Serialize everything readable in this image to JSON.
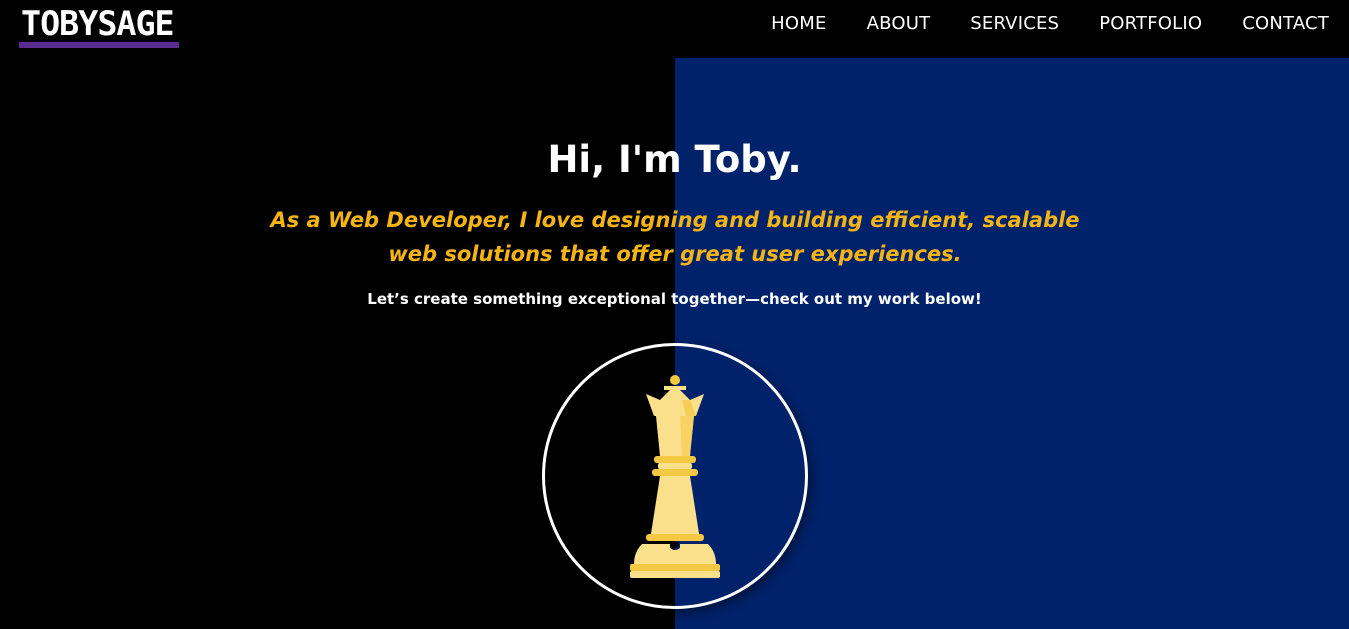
{
  "header": {
    "logo_text": "TOBYSAGE",
    "nav": [
      {
        "label": "HOME"
      },
      {
        "label": "ABOUT"
      },
      {
        "label": "SERVICES"
      },
      {
        "label": "PORTFOLIO"
      },
      {
        "label": "CONTACT"
      }
    ]
  },
  "hero": {
    "title": "Hi, I'm Toby.",
    "tagline": "As a Web Developer, I love designing and building efficient, scalable web solutions that offer great user experiences.",
    "cta": "Let’s create something exceptional together—check out my work below!",
    "avatar_icon": "chess-queen-icon"
  },
  "colors": {
    "background_left": "#000000",
    "background_right": "#00226a",
    "accent": "#f5b416",
    "logo_underline": "#5b2a8f",
    "queen_light": "#fbe08b",
    "queen_dark": "#f5c843"
  }
}
